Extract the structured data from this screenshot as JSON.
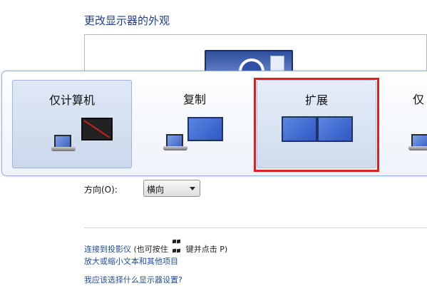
{
  "page": {
    "title": "更改显示器的外观"
  },
  "switcher": {
    "options": [
      {
        "label": "仅计算机"
      },
      {
        "label": "复制"
      },
      {
        "label": "扩展"
      },
      {
        "label": "仅"
      }
    ]
  },
  "orientation": {
    "label": "方向(O):",
    "value": "横向"
  },
  "links": {
    "projector_link": "连接到投影仪",
    "projector_hint_prefix": "(也可按住",
    "projector_hint_suffix": "键并点击 P)",
    "text_size": "放大或缩小文本和其他项目",
    "help": "我应该选择什么显示器设置?"
  },
  "colors": {
    "title": "#1e3f86",
    "link": "#1f4d9c",
    "highlight": "#e02020",
    "selected_tile": "#cbd8ec"
  }
}
